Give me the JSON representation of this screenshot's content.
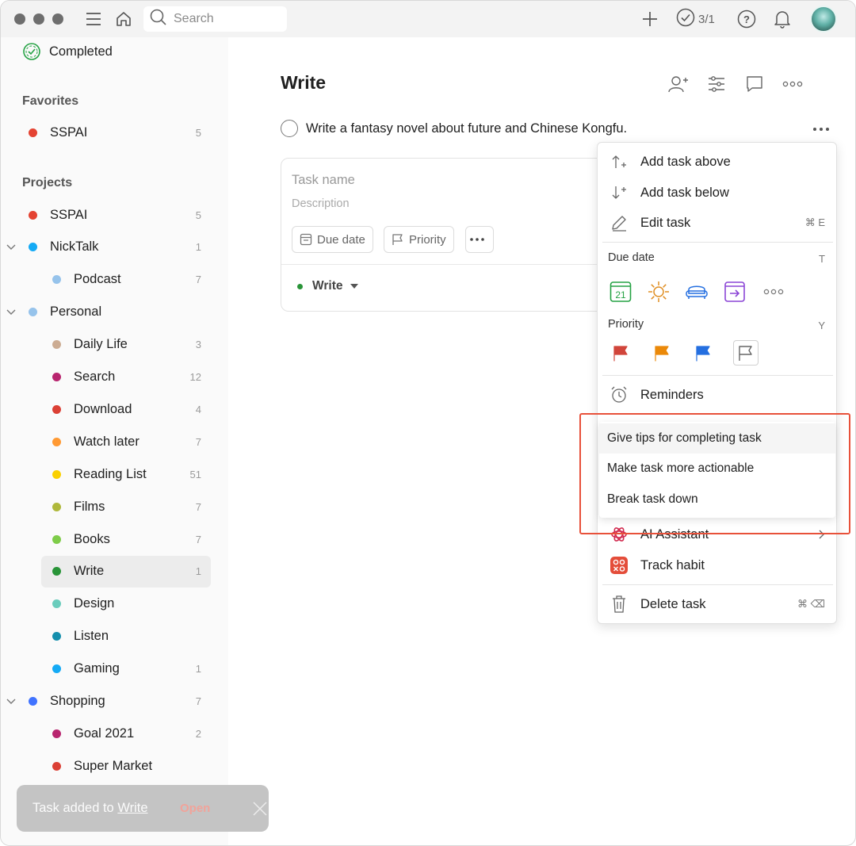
{
  "topbar": {
    "search_placeholder": "Search",
    "karma": "3/1",
    "icons": [
      "menu-icon",
      "home-icon",
      "search-icon",
      "plus-icon",
      "productivity-icon",
      "help-icon",
      "bell-icon"
    ]
  },
  "sidebar": {
    "completed_label": "Completed",
    "favorites_title": "Favorites",
    "favorites": [
      {
        "label": "SSPAI",
        "count": "5",
        "color": "#e44332"
      }
    ],
    "projects_title": "Projects",
    "projects": [
      {
        "label": "SSPAI",
        "count": "5",
        "color": "#e44332"
      },
      {
        "label": "NickTalk",
        "count": "1",
        "color": "#14aaf5"
      },
      {
        "label": "Podcast",
        "count": "7",
        "color": "#96c3eb"
      },
      {
        "label": "Personal",
        "count": "",
        "color": "#96c3eb"
      },
      {
        "label": "Daily Life",
        "count": "3",
        "color": "#ccac93"
      },
      {
        "label": "Search",
        "count": "12",
        "color": "#b8256f"
      },
      {
        "label": "Download",
        "count": "4",
        "color": "#db4035"
      },
      {
        "label": "Watch later",
        "count": "7",
        "color": "#ff9933"
      },
      {
        "label": "Reading List",
        "count": "51",
        "color": "#fad000"
      },
      {
        "label": "Films",
        "count": "7",
        "color": "#afb83b"
      },
      {
        "label": "Books",
        "count": "7",
        "color": "#7ecc49"
      },
      {
        "label": "Write",
        "count": "1",
        "color": "#299438"
      },
      {
        "label": "Design",
        "count": "",
        "color": "#6accbc"
      },
      {
        "label": "Listen",
        "count": "",
        "color": "#158fad"
      },
      {
        "label": "Gaming",
        "count": "1",
        "color": "#14aaf5"
      },
      {
        "label": "Shopping",
        "count": "7",
        "color": "#4073ff"
      },
      {
        "label": "Goal 2021",
        "count": "2",
        "color": "#b8256f"
      },
      {
        "label": "Super Market",
        "count": "",
        "color": "#db4035"
      }
    ]
  },
  "main": {
    "title": "Write",
    "task_text": "Write a fantasy novel about future and Chinese Kongfu.",
    "editor": {
      "name_placeholder": "Task name",
      "description_placeholder": "Description",
      "due_date_label": "Due date",
      "priority_label": "Priority",
      "project_label": "Write"
    }
  },
  "menu": {
    "add_above": "Add task above",
    "add_below": "Add task below",
    "edit_task": "Edit task",
    "edit_shortcut": "⌘ E",
    "due_date_title": "Due date",
    "due_date_key": "T",
    "calendar_day": "21",
    "priority_title": "Priority",
    "priority_key": "Y",
    "priority_colors": [
      "#d1453b",
      "#eb8909",
      "#246fe0"
    ],
    "reminders": "Reminders",
    "ai_assistant": "AI Assistant",
    "track_habit": "Track habit",
    "delete_task": "Delete task",
    "delete_shortcut": "⌘ ⌫"
  },
  "ai_submenu": {
    "options": [
      "Give tips for completing task",
      "Make task more actionable",
      "Break task down"
    ]
  },
  "toast": {
    "prefix": "Task added to ",
    "link": "Write",
    "open": "Open"
  }
}
